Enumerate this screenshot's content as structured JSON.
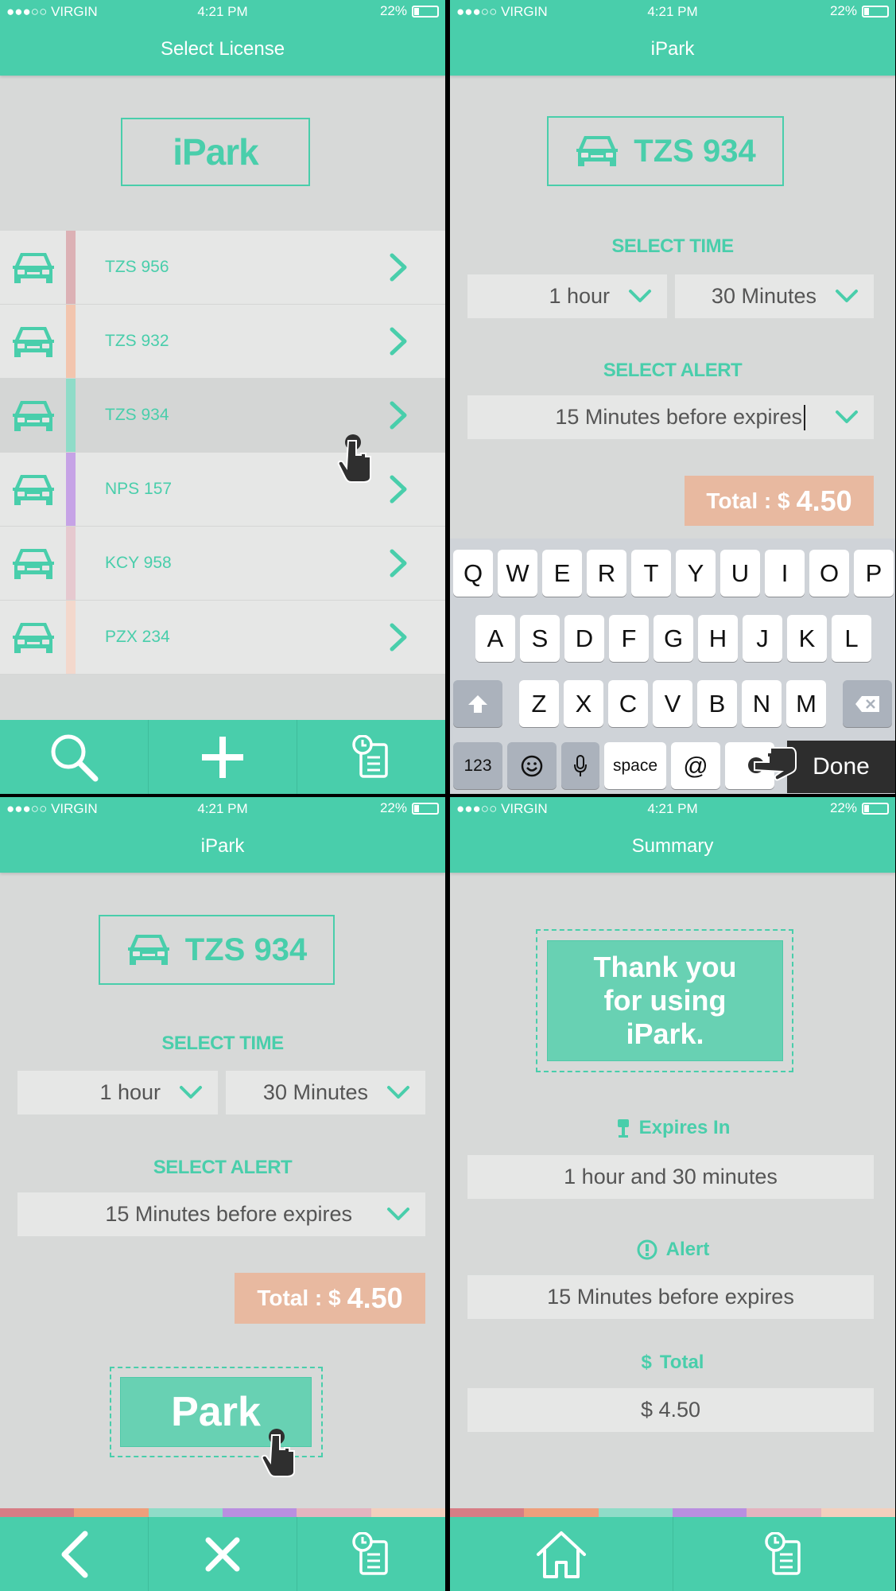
{
  "status": {
    "carrier": "●●●○○ VIRGIN",
    "time": "4:21 PM",
    "battery": "22%"
  },
  "screen1": {
    "title": "Select License",
    "logo": "iPark",
    "vehicles": [
      {
        "plate": "TZS 956",
        "color": "#dcb1b5"
      },
      {
        "plate": "TZS 932",
        "color": "#f2c5ae"
      },
      {
        "plate": "TZS 934",
        "color": "#8fdcc8"
      },
      {
        "plate": "NPS 157",
        "color": "#c6a3e6"
      },
      {
        "plate": "KCY 958",
        "color": "#e6c9cf"
      },
      {
        "plate": "PZX 234",
        "color": "#f3d8cc"
      }
    ],
    "tabs": [
      "search-icon",
      "plus-icon",
      "history-icon"
    ]
  },
  "screen2": {
    "title": "iPark",
    "plate": "TZS 934",
    "select_time": "SELECT TIME",
    "hours": "1 hour",
    "minutes": "30 Minutes",
    "select_alert": "SELECT ALERT",
    "alert": "15 Minutes before expires",
    "total_label": "Total : $",
    "total_amount": "4.50",
    "keys_row1": [
      "Q",
      "W",
      "E",
      "R",
      "T",
      "Y",
      "U",
      "I",
      "O",
      "P"
    ],
    "keys_row2": [
      "A",
      "S",
      "D",
      "F",
      "G",
      "H",
      "J",
      "K",
      "L"
    ],
    "keys_row3": [
      "Z",
      "X",
      "C",
      "V",
      "B",
      "N",
      "M"
    ],
    "key_123": "123",
    "key_space": "space",
    "key_at": "@",
    "key_done": "Done"
  },
  "screen3": {
    "title": "iPark",
    "plate": "TZS 934",
    "select_time": "SELECT TIME",
    "hours": "1 hour",
    "minutes": "30 Minutes",
    "select_alert": "SELECT ALERT",
    "alert": "15 Minutes before expires",
    "total_label": "Total : $",
    "total_amount": "4.50",
    "park": "Park"
  },
  "screen4": {
    "title": "Summary",
    "thanks_1": "Thank you",
    "thanks_2": "for using",
    "thanks_3": "iPark.",
    "expires_label": "Expires In",
    "expires_value": "1 hour and 30 minutes",
    "alert_label": "Alert",
    "alert_value": "15 Minutes before expires",
    "total_label": "Total",
    "total_value": "$ 4.50"
  },
  "strip_colors": [
    "#d77d85",
    "#ee9f7c",
    "#8fdcc8",
    "#b98fe0",
    "#e4b4bf",
    "#f3cfbd"
  ],
  "accent": "#49ceab"
}
